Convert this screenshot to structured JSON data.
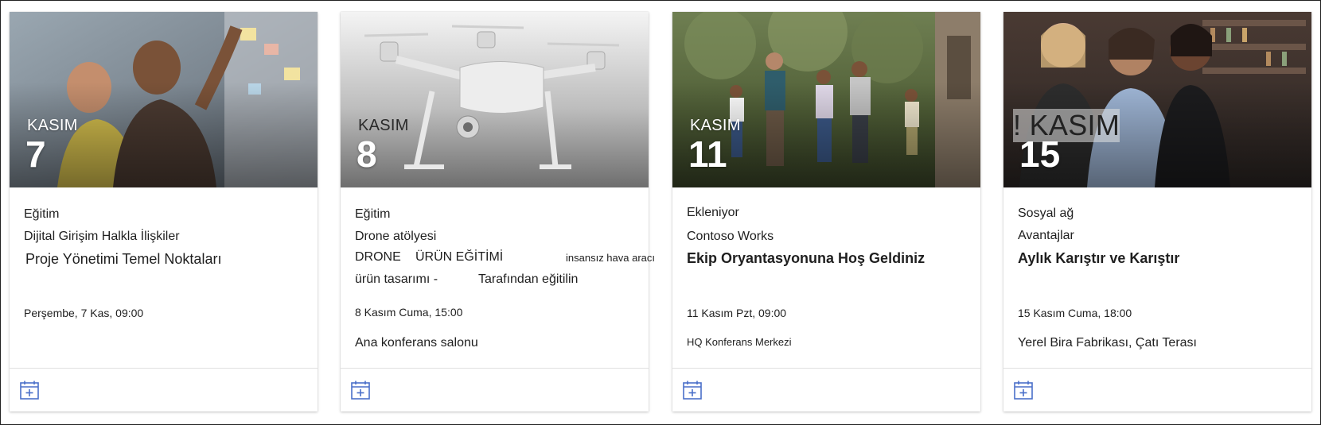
{
  "events": [
    {
      "month": "KASIM",
      "day": "7",
      "category": "Eğitim",
      "subtitle": "Dijital Girişim Halkla İlişkiler",
      "title": "Proje Yönetimi Temel Noktaları",
      "datetime": "Perşembe, 7 Kas, 09:00",
      "location": ""
    },
    {
      "month": "KASIM",
      "day": "8",
      "category": "Eğitim",
      "subtitle": "Drone atölyesi",
      "title_part1": "DRONE",
      "title_part2": "ÜRÜN EĞİTİMİ",
      "title_part3": "insansız hava aracı",
      "desc_part1": "ürün tasarımı -",
      "desc_part2": "Tarafından eğitilin",
      "datetime": "8 Kasım Cuma, 15:00",
      "location": "Ana konferans salonu"
    },
    {
      "month": "KASIM",
      "day": "11",
      "category": "Ekleniyor",
      "subtitle": "Contoso Works",
      "title": "Ekip Oryantasyonuna Hoş Geldiniz",
      "datetime": "11 Kasım Pzt, 09:00",
      "location": "HQ Konferans Merkezi"
    },
    {
      "month": "! KASIM",
      "day": "15",
      "category": "Sosyal ağ",
      "subtitle": "Avantajlar",
      "title": "Aylık Karıştır ve Karıştır",
      "datetime": "15 Kasım Cuma, 18:00",
      "location": "Yerel Bira Fabrikası, Çatı Terası"
    }
  ],
  "icons": {
    "add_to_calendar": "calendar-add-icon"
  },
  "colors": {
    "accent": "#4a6fc9",
    "text": "#1f1f1f",
    "divider": "#e1e1e1"
  }
}
